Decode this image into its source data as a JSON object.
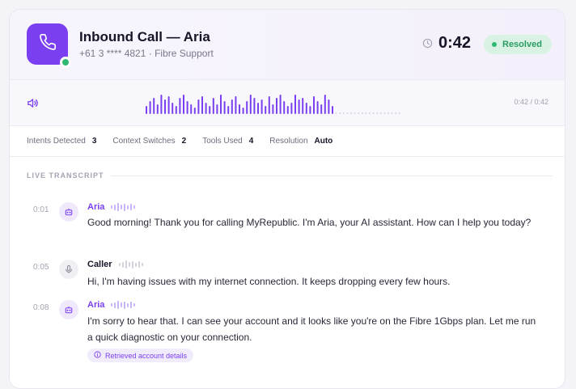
{
  "call": {
    "title": "Inbound Call — Aria",
    "subtitle": "+61 3 **** 4821 · Fibre Support",
    "duration": "0:42",
    "status": "Resolved",
    "status_color": "#2eb872",
    "brand_color": "#7a3ff0",
    "icons": {
      "avatar": "phone-icon",
      "timer": "clock-icon"
    }
  },
  "playback": {
    "position": "0:42 / 0:42",
    "progress": 1.0,
    "icon": "speaker-icon",
    "played_bar_heights": [
      10,
      16,
      20,
      12,
      24,
      18,
      22,
      14,
      10,
      20,
      24,
      16,
      12,
      8,
      18,
      22,
      14,
      10,
      20,
      12,
      24,
      16,
      10,
      18,
      22,
      12,
      8,
      16,
      24,
      20,
      14,
      18,
      10,
      22,
      12,
      20,
      24,
      16,
      10,
      14,
      24,
      18,
      20,
      14,
      10,
      22,
      16,
      12,
      24,
      18,
      10
    ],
    "remaining_bar_count": 18
  },
  "stats": [
    {
      "label": "Intents Detected",
      "value": "3"
    },
    {
      "label": "Context Switches",
      "value": "2"
    },
    {
      "label": "Tools Used",
      "value": "4"
    },
    {
      "label": "Resolution",
      "value": "Auto"
    }
  ],
  "transcript": {
    "label": "LIVE TRANSCRIPT",
    "messages": [
      {
        "time": "0:01",
        "speaker": "Aria",
        "role": "ai",
        "icon": "bot-icon",
        "text": "Good morning! Thank you for calling MyRepublic. I'm Aria, your AI assistant. How can I help you today?"
      },
      {
        "time": "0:05",
        "speaker": "Caller",
        "role": "user",
        "icon": "mic-icon",
        "text": "Hi, I'm having issues with my internet connection. It keeps dropping every few hours."
      },
      {
        "time": "0:08",
        "speaker": "Aria",
        "role": "ai",
        "icon": "bot-icon",
        "text": "I'm sorry to hear that. I can see your account and it looks like you're on the Fibre 1Gbps plan. Let me run a quick diagnostic on your connection.",
        "tool": "Retrieved account details"
      }
    ]
  }
}
